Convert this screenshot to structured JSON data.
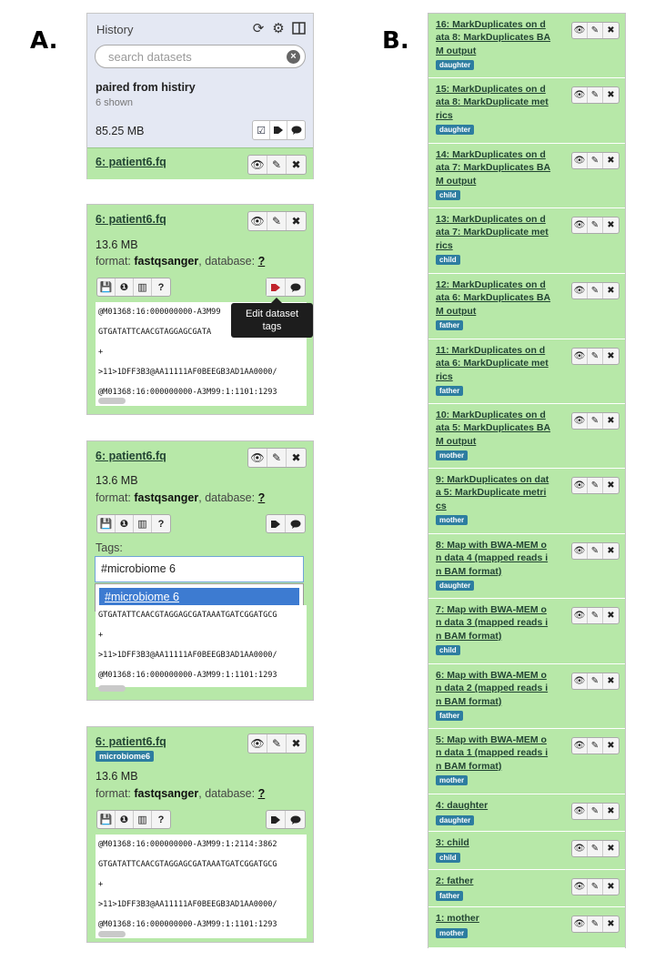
{
  "labels": {
    "a": "A.",
    "b": "B."
  },
  "history": {
    "title": "History",
    "search_placeholder": "search datasets",
    "name": "paired from histiry",
    "shown": "6 shown",
    "size": "85.25 MB",
    "icons": [
      "refresh-icon",
      "gear-icon",
      "columns-icon"
    ]
  },
  "dataset": {
    "title": "6: patient6.fq",
    "size": "13.6 MB",
    "format_label": "format:",
    "format": "fastqsanger",
    "database_label": ", database:",
    "database": "?",
    "tags_label": "Tags:",
    "tag_input": "#microbiome 6",
    "tag_suggestion": "#microbiome 6",
    "tag": "microbiome6",
    "tooltip": "Edit dataset tags",
    "peek": [
      "@M01368:16:000000000-A3M99:1:2114:3862",
      "GTGATATTCAACGTAGGAGCGATAAATGATCGGATGCG",
      "+",
      ">11>1DFF3B3@AA11111AF0BEEGB3AD1AA0000/",
      "@M01368:16:000000000-A3M99:1:1101:1293"
    ],
    "peek_partial": "@M01368:16:000000000-A3M99",
    "peek_partial_2": "GTGATATTCAACGTAGGAGCGATA"
  },
  "list": [
    {
      "title": "16: MarkDuplicates on data 8: MarkDuplicates BAM output",
      "tag": "daughter"
    },
    {
      "title": "15: MarkDuplicates on data 8: MarkDuplicate metrics",
      "tag": "daughter"
    },
    {
      "title": "14: MarkDuplicates on data 7: MarkDuplicates BAM output",
      "tag": "child"
    },
    {
      "title": "13: MarkDuplicates on data 7: MarkDuplicate metrics",
      "tag": "child"
    },
    {
      "title": "12: MarkDuplicates on data 6: MarkDuplicates BAM output",
      "tag": "father"
    },
    {
      "title": "11: MarkDuplicates on data 6: MarkDuplicate metrics",
      "tag": "father"
    },
    {
      "title": "10: MarkDuplicates on data 5: MarkDuplicates BAM output",
      "tag": "mother"
    },
    {
      "title": "9: MarkDuplicates on data 5: MarkDuplicate metrics",
      "tag": "mother"
    },
    {
      "title": "8: Map with BWA-MEM on data 4 (mapped reads in BAM format)",
      "tag": "daughter"
    },
    {
      "title": "7: Map with BWA-MEM on data 3 (mapped reads in BAM format)",
      "tag": "child"
    },
    {
      "title": "6: Map with BWA-MEM on data 2 (mapped reads in BAM format)",
      "tag": "father"
    },
    {
      "title": "5: Map with BWA-MEM on data 1 (mapped reads in BAM format)",
      "tag": "mother"
    },
    {
      "title": "4: daughter",
      "tag": "daughter"
    },
    {
      "title": "3: child",
      "tag": "child"
    },
    {
      "title": "2: father",
      "tag": "father"
    },
    {
      "title": "1: mother",
      "tag": "mother"
    }
  ],
  "colors": {
    "dataset_ok": "#b7e8a8",
    "history_bg": "#e4e8f3",
    "tag_badge": "#2d7da0",
    "tag_active": "#c0232b",
    "highlight": "#3d7bd1"
  }
}
